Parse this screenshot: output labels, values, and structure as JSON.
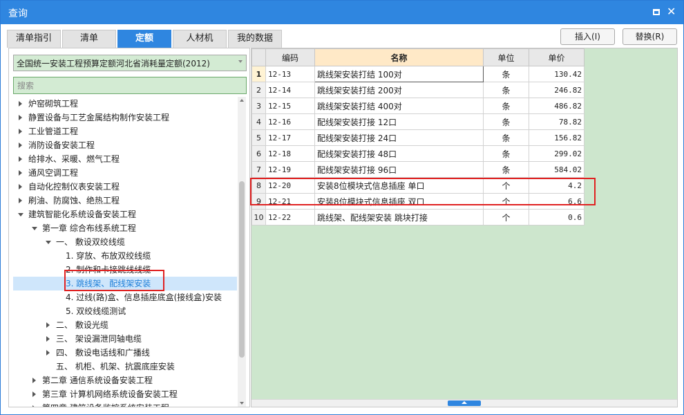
{
  "window": {
    "title": "查询"
  },
  "tabs": [
    {
      "label": "清单指引",
      "active": false
    },
    {
      "label": "清单",
      "active": false
    },
    {
      "label": "定额",
      "active": true
    },
    {
      "label": "人材机",
      "active": false
    },
    {
      "label": "我的数据",
      "active": false
    }
  ],
  "toolbar": {
    "insert_label": "插入(I)",
    "replace_label": "替换(R)"
  },
  "left": {
    "quota_library": "全国统一安装工程预算定额河北省消耗量定额(2012)",
    "search_placeholder": "搜索",
    "tree": [
      {
        "label": "炉窑砌筑工程",
        "level": 0,
        "toggle": "collapsed"
      },
      {
        "label": "静置设备与工艺金属结构制作安装工程",
        "level": 0,
        "toggle": "collapsed"
      },
      {
        "label": "工业管道工程",
        "level": 0,
        "toggle": "collapsed"
      },
      {
        "label": "消防设备安装工程",
        "level": 0,
        "toggle": "collapsed"
      },
      {
        "label": "给排水、采暖、燃气工程",
        "level": 0,
        "toggle": "collapsed"
      },
      {
        "label": "通风空调工程",
        "level": 0,
        "toggle": "collapsed"
      },
      {
        "label": "自动化控制仪表安装工程",
        "level": 0,
        "toggle": "collapsed"
      },
      {
        "label": "刷油、防腐蚀、绝热工程",
        "level": 0,
        "toggle": "collapsed"
      },
      {
        "label": "建筑智能化系统设备安装工程",
        "level": 0,
        "toggle": "expanded"
      },
      {
        "label": "第一章 综合布线系统工程",
        "level": 1,
        "toggle": "expanded"
      },
      {
        "label": "一、 敷设双绞线缆",
        "level": 2,
        "toggle": "expanded"
      },
      {
        "label": "1. 穿放、布放双绞线缆",
        "level": 3,
        "toggle": "none"
      },
      {
        "label": "2. 制作和卡接跳线线缆",
        "level": 3,
        "toggle": "none"
      },
      {
        "label": "3. 跳线架、配线架安装",
        "level": 3,
        "toggle": "none",
        "selected": true
      },
      {
        "label": "4. 过线(路)盒、信息插座底盒(接线盒)安装",
        "level": 3,
        "toggle": "none"
      },
      {
        "label": "5. 双绞线缆测试",
        "level": 3,
        "toggle": "none"
      },
      {
        "label": "二、 敷设光缆",
        "level": 2,
        "toggle": "collapsed"
      },
      {
        "label": "三、 架设漏泄同轴电缆",
        "level": 2,
        "toggle": "collapsed"
      },
      {
        "label": "四、 敷设电话线和广播线",
        "level": 2,
        "toggle": "collapsed"
      },
      {
        "label": "五、 机柜、机架、抗震底座安装",
        "level": 2,
        "toggle": "none"
      },
      {
        "label": "第二章 通信系统设备安装工程",
        "level": 1,
        "toggle": "collapsed"
      },
      {
        "label": "第三章 计算机网络系统设备安装工程",
        "level": 1,
        "toggle": "collapsed"
      },
      {
        "label": "第四章 建筑设备监控系统安装工程",
        "level": 1,
        "toggle": "collapsed"
      }
    ]
  },
  "grid": {
    "headers": {
      "code": "编码",
      "name": "名称",
      "unit": "单位",
      "price": "单价"
    },
    "rows": [
      {
        "no": "1",
        "code": "12-13",
        "name": "跳线架安装打结 100对",
        "unit": "条",
        "price": "130.42"
      },
      {
        "no": "2",
        "code": "12-14",
        "name": "跳线架安装打结 200对",
        "unit": "条",
        "price": "246.82"
      },
      {
        "no": "3",
        "code": "12-15",
        "name": "跳线架安装打结 400对",
        "unit": "条",
        "price": "486.82"
      },
      {
        "no": "4",
        "code": "12-16",
        "name": "配线架安装打接 12口",
        "unit": "条",
        "price": "78.82"
      },
      {
        "no": "5",
        "code": "12-17",
        "name": "配线架安装打接 24口",
        "unit": "条",
        "price": "156.82"
      },
      {
        "no": "6",
        "code": "12-18",
        "name": "配线架安装打接 48口",
        "unit": "条",
        "price": "299.02"
      },
      {
        "no": "7",
        "code": "12-19",
        "name": "配线架安装打接 96口",
        "unit": "条",
        "price": "584.02"
      },
      {
        "no": "8",
        "code": "12-20",
        "name": "安装8位模块式信息插座 单口",
        "unit": "个",
        "price": "4.2"
      },
      {
        "no": "9",
        "code": "12-21",
        "name": "安装8位模块式信息插座 双口",
        "unit": "个",
        "price": "6.6"
      },
      {
        "no": "10",
        "code": "12-22",
        "name": "跳线架、配线架安装 跳块打接",
        "unit": "个",
        "price": "0.6"
      }
    ]
  },
  "colors": {
    "accent": "#2f86e0",
    "highlight_box": "#e02020",
    "green_bg": "#cde6cd",
    "header_name_bg": "#ffe9c7",
    "tree_selected": "#1e7fd8"
  }
}
